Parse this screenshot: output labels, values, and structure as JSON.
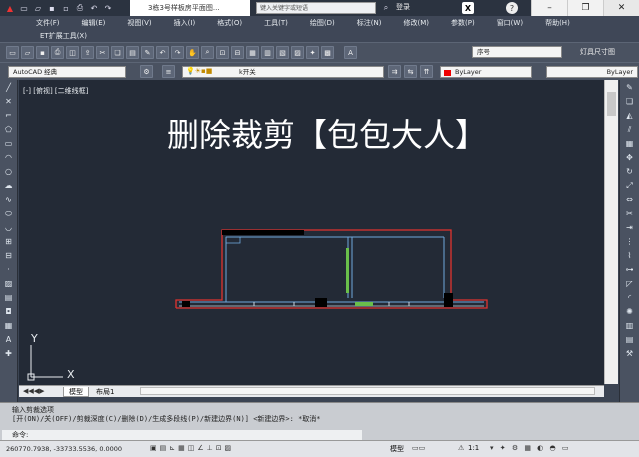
{
  "app": {
    "document_title": "3栋3号样板房平面图...",
    "search_placeholder": "键入关键字或短语",
    "login_label": "登录",
    "help_label": "?"
  },
  "menu": {
    "items": [
      "文件(F)",
      "编辑(E)",
      "视图(V)",
      "插入(I)",
      "格式(O)",
      "工具(T)",
      "绘图(D)",
      "标注(N)",
      "修改(M)",
      "参数(P)",
      "窗口(W)",
      "帮助(H)"
    ],
    "secondary_item": "ET扩展工具(X)"
  },
  "toolbar": {
    "style_select": "序号",
    "dimension_label": "灯具尺寸图",
    "workspace_select": "AutoCAD 经典",
    "layer_select": "k开关",
    "color_select": "ByLayer",
    "linetype_select": "ByLayer"
  },
  "viewport": {
    "label": "[-] [俯视] [二维线框]",
    "overlay_title": "删除裁剪【包包大人】",
    "axis_x": "X",
    "axis_y": "Y"
  },
  "tabs": {
    "model": "模型",
    "layout": "布局1"
  },
  "command": {
    "line1": "输入剪裁选项",
    "line2": "[开(ON)/关(OFF)/剪裁深度(C)/删除(D)/生成多段线(P)/新建边界(N)] <新建边界>: *取消*",
    "prompt": "命令:"
  },
  "status": {
    "coords": "260770.7938, -33733.5536, 0.0000",
    "model_label": "模型",
    "scale_label": "1:1"
  },
  "colors": {
    "canvas_bg": "#232a36",
    "wall_red": "#e0332f",
    "wall_blue": "#6fa8dc"
  }
}
